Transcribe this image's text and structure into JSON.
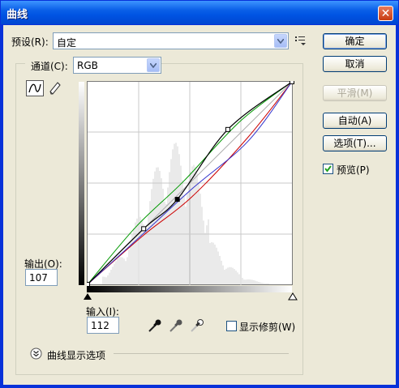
{
  "window": {
    "title": "曲线",
    "close_glyph": "✕"
  },
  "preset": {
    "label": "预设(R):",
    "value": "自定"
  },
  "channel": {
    "label": "通道(C):",
    "value": "RGB"
  },
  "buttons": {
    "ok": "确定",
    "cancel": "取消",
    "smooth": "平滑(M)",
    "auto": "自动(A)",
    "options": "选项(T)..."
  },
  "preview": {
    "label": "预览(P)",
    "checked": true
  },
  "output": {
    "label": "输出(O):",
    "value": "107"
  },
  "input": {
    "label": "输入(I):",
    "value": "112"
  },
  "show_clipping": {
    "label": "显示修剪(W)",
    "checked": false
  },
  "curve_display_options": {
    "label": "曲线显示选项"
  },
  "curves": {
    "points": [
      [
        0,
        0
      ],
      [
        70,
        70
      ],
      [
        112,
        107
      ],
      [
        175,
        195
      ],
      [
        255,
        255
      ]
    ],
    "selected_point": [
      112,
      107
    ],
    "colors": {
      "composite": "#000000",
      "red": "#cc0000",
      "green": "#009900",
      "blue": "#3333cc"
    }
  },
  "icons": [
    "curve-tool-icon",
    "pencil-tool-icon",
    "preset-menu-icon",
    "black-eyedropper-icon",
    "gray-eyedropper-icon",
    "white-eyedropper-icon",
    "expand-icon"
  ]
}
